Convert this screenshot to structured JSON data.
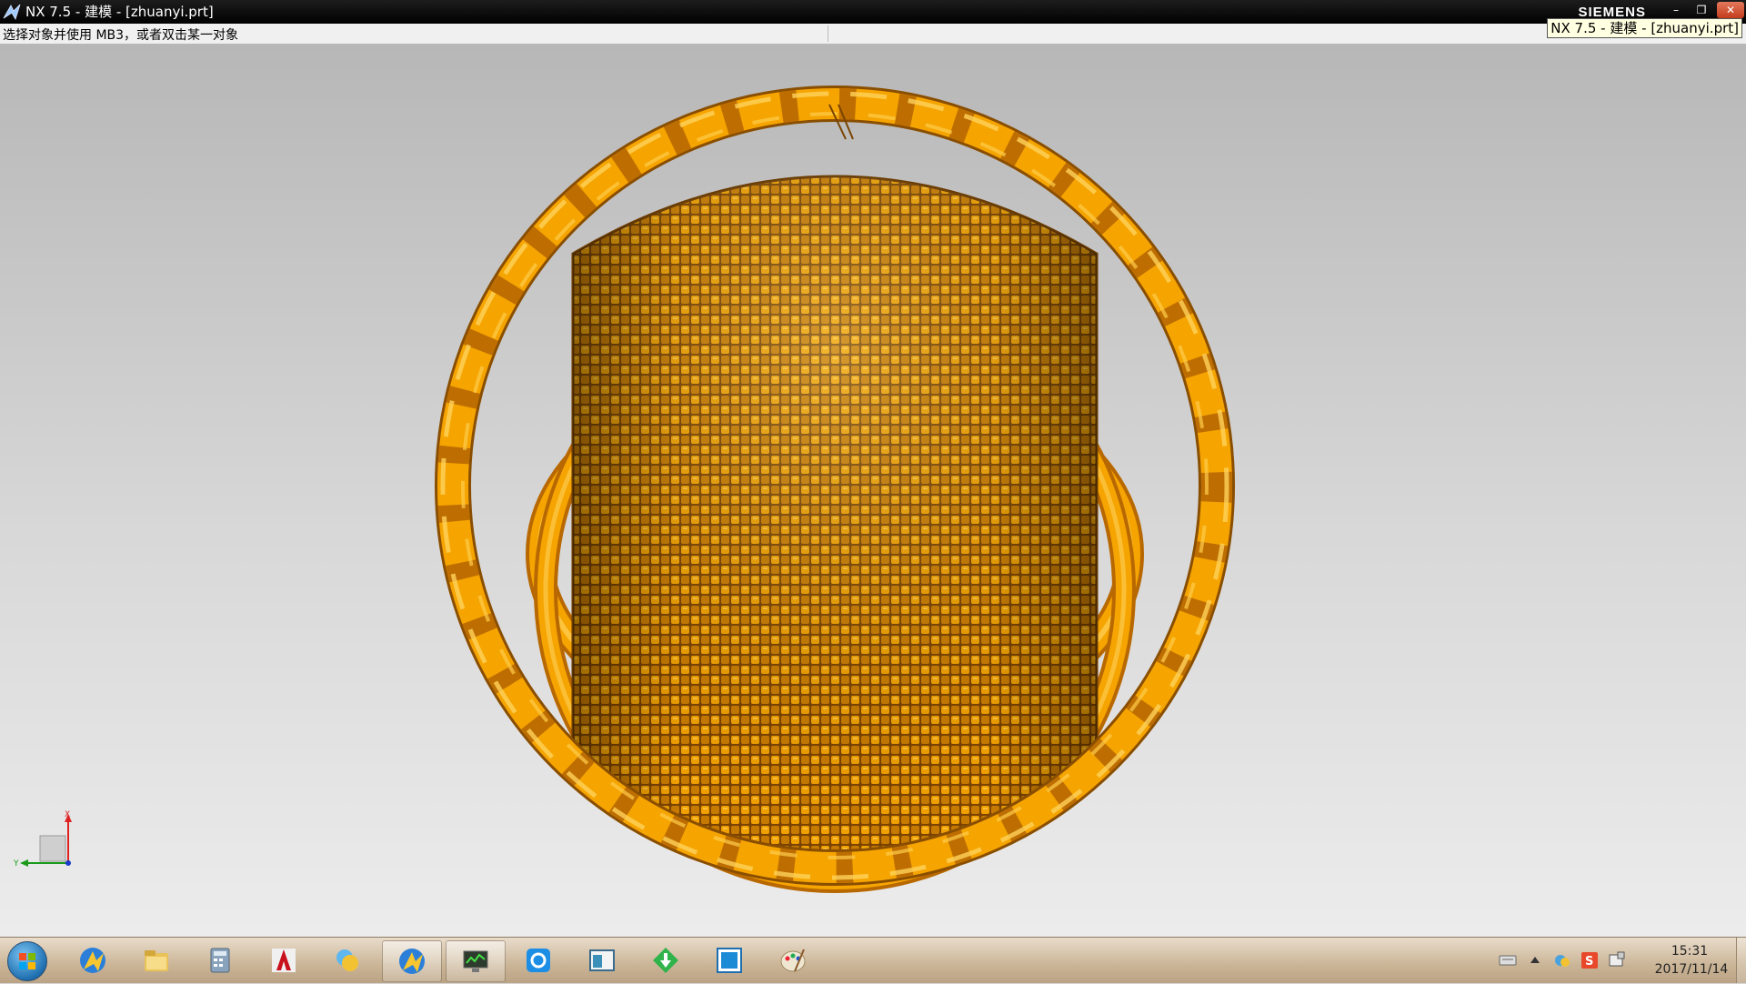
{
  "window": {
    "title": "NX 7.5 - 建模 - [zhuanyi.prt]",
    "brand": "SIEMENS",
    "tooltip": "NX 7.5 - 建模 - [zhuanyi.prt]",
    "controls": {
      "minimize": "–",
      "maximize": "❐",
      "close": "✕"
    }
  },
  "cue_line": {
    "prompt": "选择对象并使用 MB3，或者双击某一对象"
  },
  "viewport": {
    "model_colors": {
      "rope": "#F5A400",
      "rope_shadow": "#B86800",
      "rope_highlight": "#FFD25A",
      "weave": "#E08A00",
      "weave_dark": "#7A4300"
    },
    "triad": {
      "x_label": "X",
      "y_label": "Y"
    }
  },
  "taskbar": {
    "items": [
      {
        "name": "nx-app-icon",
        "open": false
      },
      {
        "name": "explorer-folder-icon",
        "open": false
      },
      {
        "name": "calculator-icon",
        "open": false
      },
      {
        "name": "autocad-mechanical-icon",
        "open": false
      },
      {
        "name": "messenger-icon",
        "open": false
      },
      {
        "name": "nx-app-icon",
        "open": true
      },
      {
        "name": "monitor-app-icon",
        "open": true
      },
      {
        "name": "qq-icon",
        "open": false
      },
      {
        "name": "window-app-icon",
        "open": false
      },
      {
        "name": "download-arrow-icon",
        "open": false
      },
      {
        "name": "blue-square-app-icon",
        "open": false
      },
      {
        "name": "paint-palette-icon",
        "open": false
      }
    ],
    "tray": {
      "icons": [
        "keyboard-icon",
        "tray-expand-icon",
        "network-icon",
        "sogou-s-icon",
        "action-center-icon"
      ],
      "time": "15:31",
      "date": "2017/11/14"
    }
  }
}
